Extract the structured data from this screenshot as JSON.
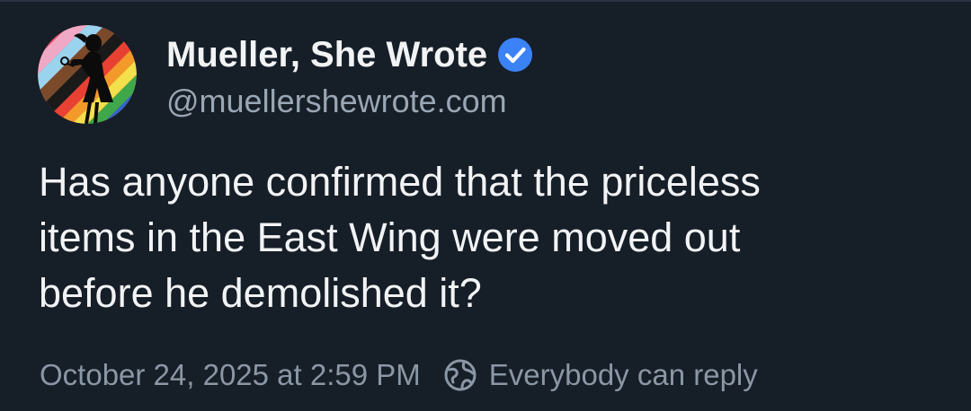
{
  "post": {
    "author": {
      "display_name": "Mueller, She Wrote",
      "handle": "@muellershewrote.com",
      "verified": true,
      "verified_color": "#3b82f6"
    },
    "text": "Has anyone confirmed that the priceless\nitems in the East Wing were moved out\nbefore he demolished it?",
    "timestamp": "October 24, 2025 at 2:59 PM",
    "reply_setting": "Everybody can reply",
    "icons": {
      "verified": "verified-check-icon",
      "reply_setting": "globe-reply-icon"
    }
  },
  "colors": {
    "background": "#161e27",
    "primary_text": "#f1f3f5",
    "secondary_text": "#9aa6b4",
    "accent": "#3b82f6"
  }
}
